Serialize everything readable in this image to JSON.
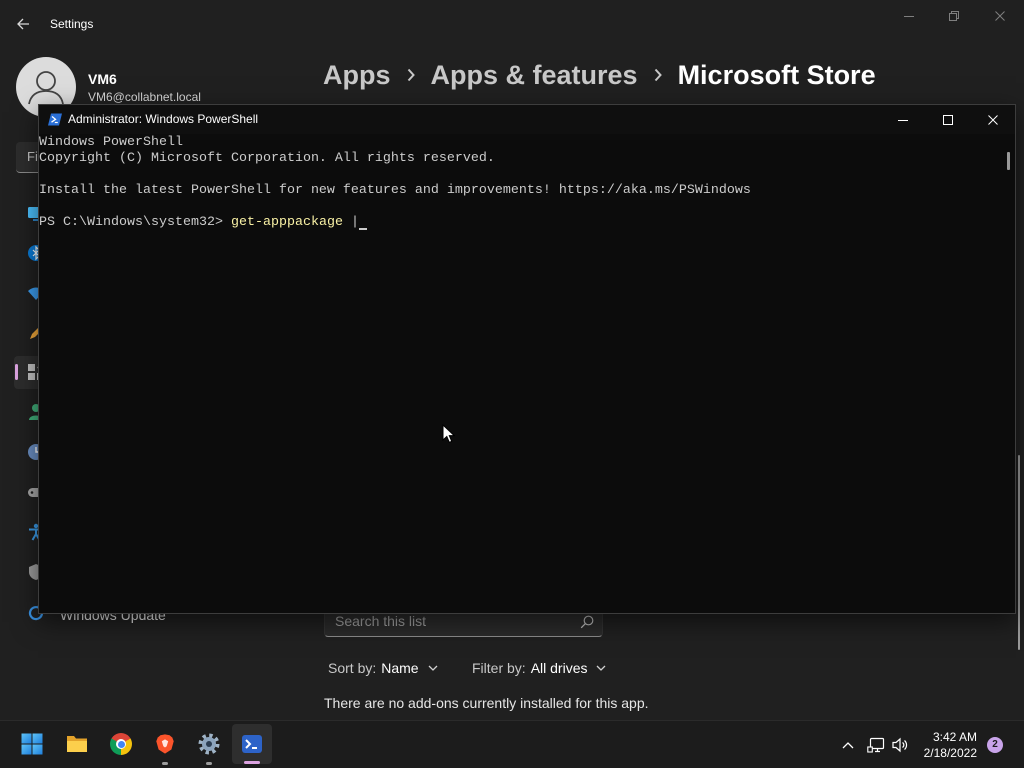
{
  "settings": {
    "title": "Settings",
    "user": {
      "name": "VM6",
      "email": "VM6@collabnet.local"
    },
    "breadcrumb": [
      "Apps",
      "Apps & features",
      "Microsoft Store"
    ],
    "sidebar": {
      "search_text": "Fi",
      "icons": [
        "system-icon",
        "bluetooth-icon",
        "network-icon",
        "personalization-icon",
        "apps-icon",
        "accounts-icon",
        "time-language-icon",
        "gaming-icon",
        "accessibility-icon",
        "privacy-icon",
        "windows-update-icon"
      ],
      "selected_icon": "apps-icon",
      "visible_label": "Windows Update"
    },
    "addons": {
      "search_placeholder": "Search this list",
      "sort_label": "Sort by:",
      "sort_value": "Name",
      "filter_label": "Filter by:",
      "filter_value": "All drives",
      "empty_message": "There are no add-ons currently installed for this app."
    }
  },
  "powershell": {
    "title": "Administrator: Windows PowerShell",
    "output": [
      "Windows PowerShell",
      "Copyright (C) Microsoft Corporation. All rights reserved.",
      "",
      "Install the latest PowerShell for new features and improvements! https://aka.ms/PSWindows",
      ""
    ],
    "prompt": "PS C:\\Windows\\system32>",
    "command": "get-apppackage",
    "pipe": "|"
  },
  "taskbar": {
    "pinned_icons": [
      "start-icon",
      "file-explorer-icon",
      "chrome-icon",
      "brave-icon",
      "settings-icon",
      "powershell-icon"
    ],
    "active_icon": "powershell-icon",
    "tray_icons": [
      "chevron-up-icon",
      "network-icon",
      "volume-icon"
    ],
    "time": "3:42 AM",
    "date": "2/18/2022",
    "notification_count": "2"
  },
  "colors": {
    "accent": "#dba2e0",
    "settings_background": "#202020",
    "terminal_background": "#0c0c0c",
    "terminal_text": "#cccccc",
    "command_text": "#f9f1a5",
    "taskbar_background": "#1c1c1c",
    "secondary_text": "#c8c8c8"
  }
}
